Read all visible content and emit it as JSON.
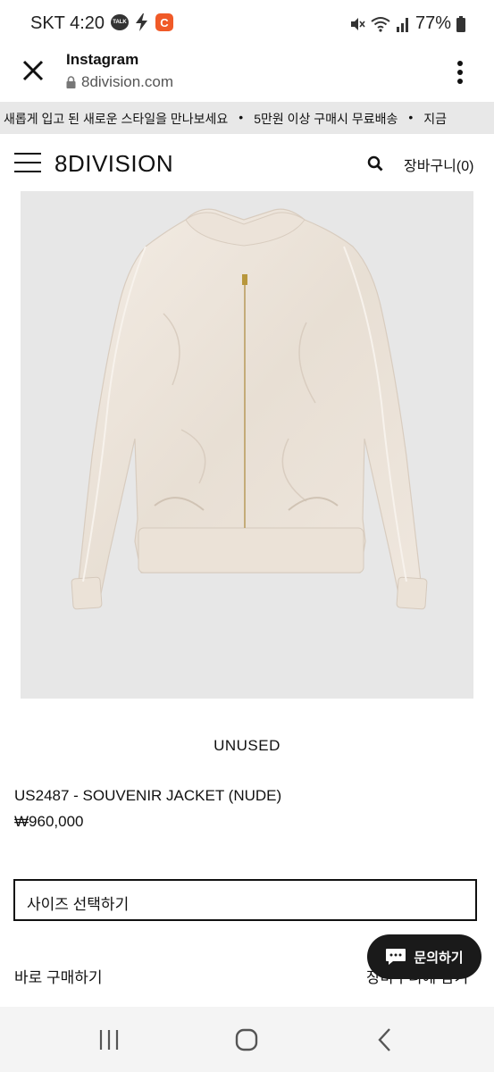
{
  "status_bar": {
    "time": "4:20",
    "carrier": "SKT",
    "talk_badge": "TALK",
    "app_badge": "C",
    "battery": "77%"
  },
  "browser": {
    "title": "Instagram",
    "url": "8division.com"
  },
  "marquee": {
    "items": [
      "새롭게 입고 된 새로운 스타일을 만나보세요",
      "5만원 이상 구매시 무료배송",
      "지금"
    ]
  },
  "site": {
    "logo": "8DIVISION",
    "cart_label": "장바구니(0)"
  },
  "product": {
    "condition": "UNUSED",
    "name": "US2487 - SOUVENIR JACKET (NUDE)",
    "price": "₩960,000",
    "size_select_label": "사이즈 선택하기",
    "buy_now_label": "바로 구매하기",
    "add_to_cart_label": "장바구니에 담기"
  },
  "chat": {
    "label": "문의하기"
  },
  "colors": {
    "accent_orange": "#f05a28",
    "fab_bg": "#1a1a1a",
    "marquee_bg": "#e8e8e8",
    "image_bg": "#e7e7e7"
  }
}
